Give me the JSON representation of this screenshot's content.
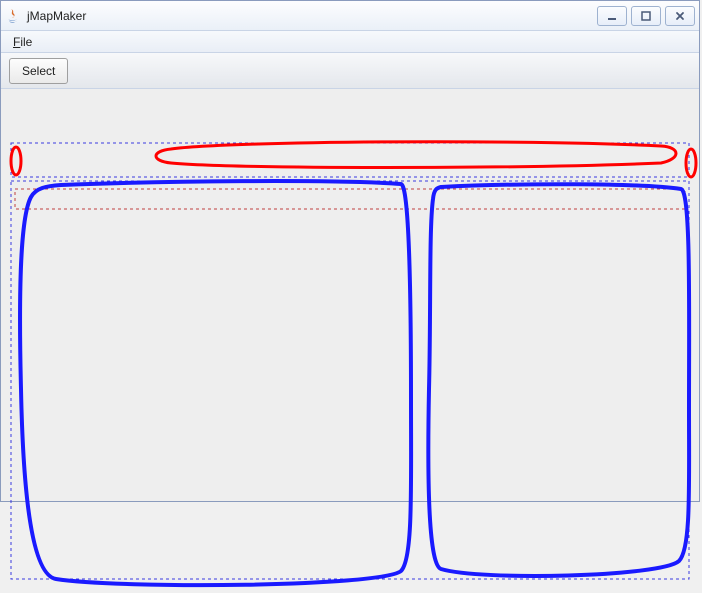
{
  "window": {
    "title": "jMapMaker"
  },
  "menubar": {
    "items": [
      {
        "label": "File",
        "mnemonic": "F"
      }
    ]
  },
  "toolbar": {
    "select_label": "Select"
  },
  "annotations": {
    "stroke_red": "#ff0000",
    "stroke_blue": "#1a1aff"
  }
}
